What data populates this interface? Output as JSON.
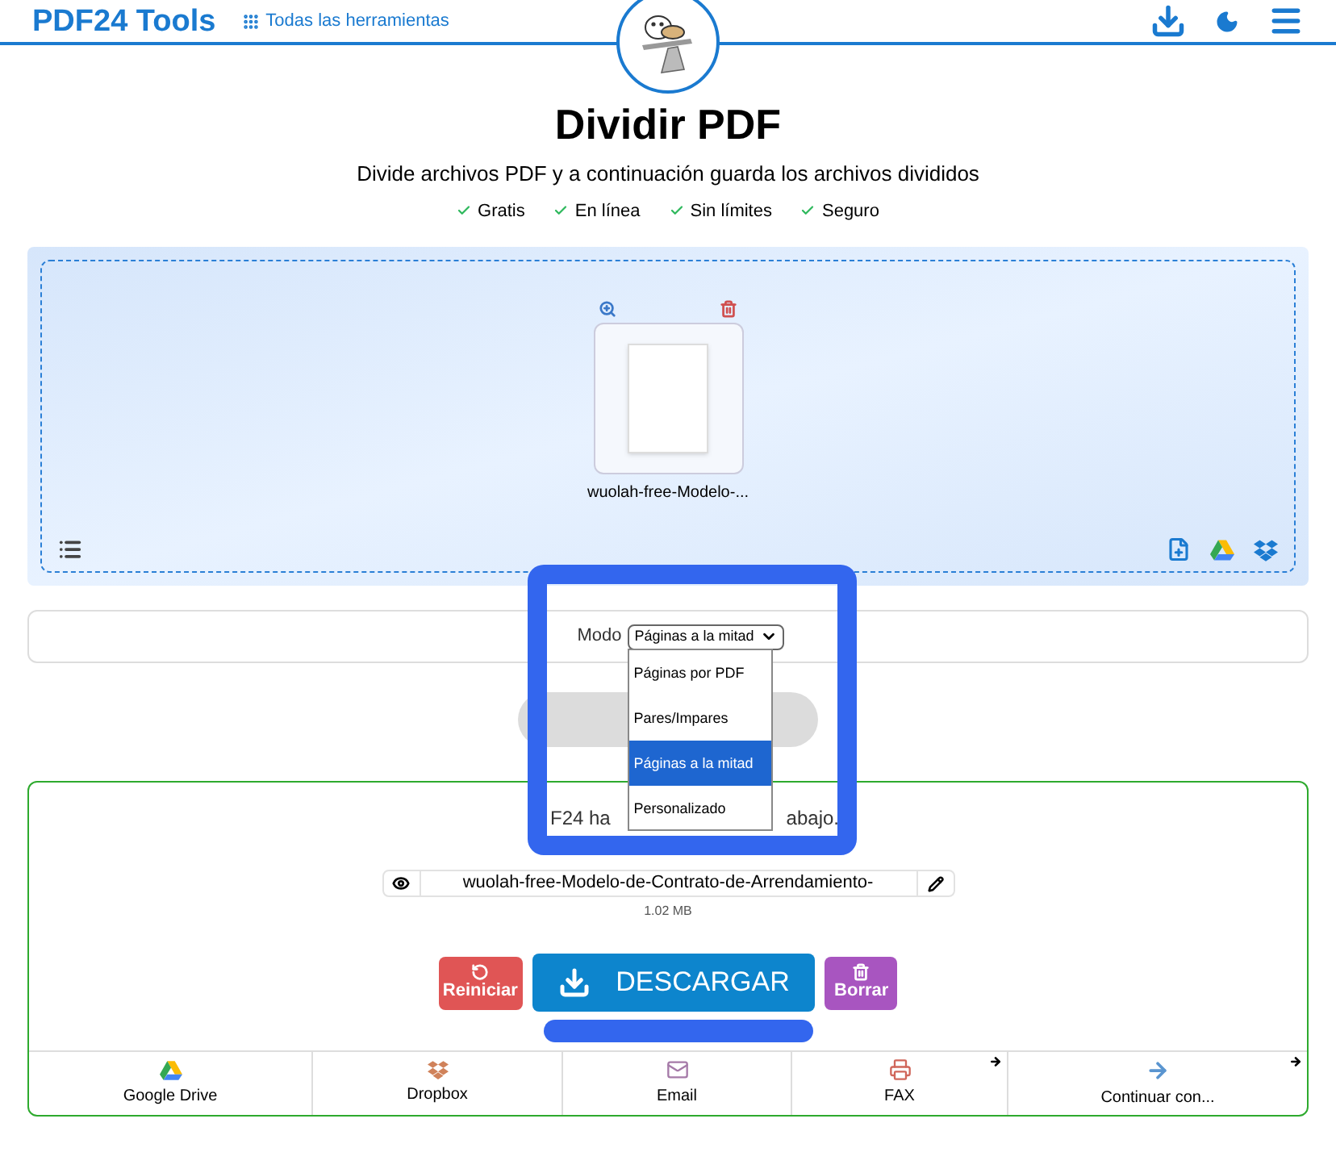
{
  "header": {
    "brand": "PDF24 Tools",
    "all_tools": "Todas las herramientas"
  },
  "hero": {
    "title": "Dividir PDF",
    "subtitle": "Divide archivos PDF y a continuación guarda los archivos divididos",
    "features": [
      "Gratis",
      "En línea",
      "Sin límites",
      "Seguro"
    ]
  },
  "upload": {
    "files": [
      {
        "name": "wuolah-free-Modelo-..."
      }
    ]
  },
  "options": {
    "label": "Modo",
    "value": "Páginas a la mitad",
    "expanded": true,
    "choices": [
      {
        "label": "Páginas por PDF",
        "selected": false
      },
      {
        "label": "Pares/Impares",
        "selected": false
      },
      {
        "label": "Páginas a la mitad",
        "selected": true
      },
      {
        "label": "Personalizado",
        "selected": false
      }
    ]
  },
  "result": {
    "message_start": "F24 ha",
    "message_end": "abajo.",
    "file_name": "wuolah-free-Modelo-de-Contrato-de-Arrendamiento-",
    "file_size": "1.02 MB",
    "buttons": [
      {
        "kind": "reset",
        "label": "Reiniciar"
      },
      {
        "kind": "download",
        "label": "DESCARGAR"
      },
      {
        "kind": "delete",
        "label": "Borrar"
      }
    ],
    "destinations": [
      {
        "kind": "drive",
        "label": "Google Drive",
        "external": false
      },
      {
        "kind": "dropbox",
        "label": "Dropbox",
        "external": false
      },
      {
        "kind": "email",
        "label": "Email",
        "external": false
      },
      {
        "kind": "fax",
        "label": "FAX",
        "external": true
      },
      {
        "kind": "continue",
        "label": "Continuar con...",
        "external": true
      }
    ]
  }
}
